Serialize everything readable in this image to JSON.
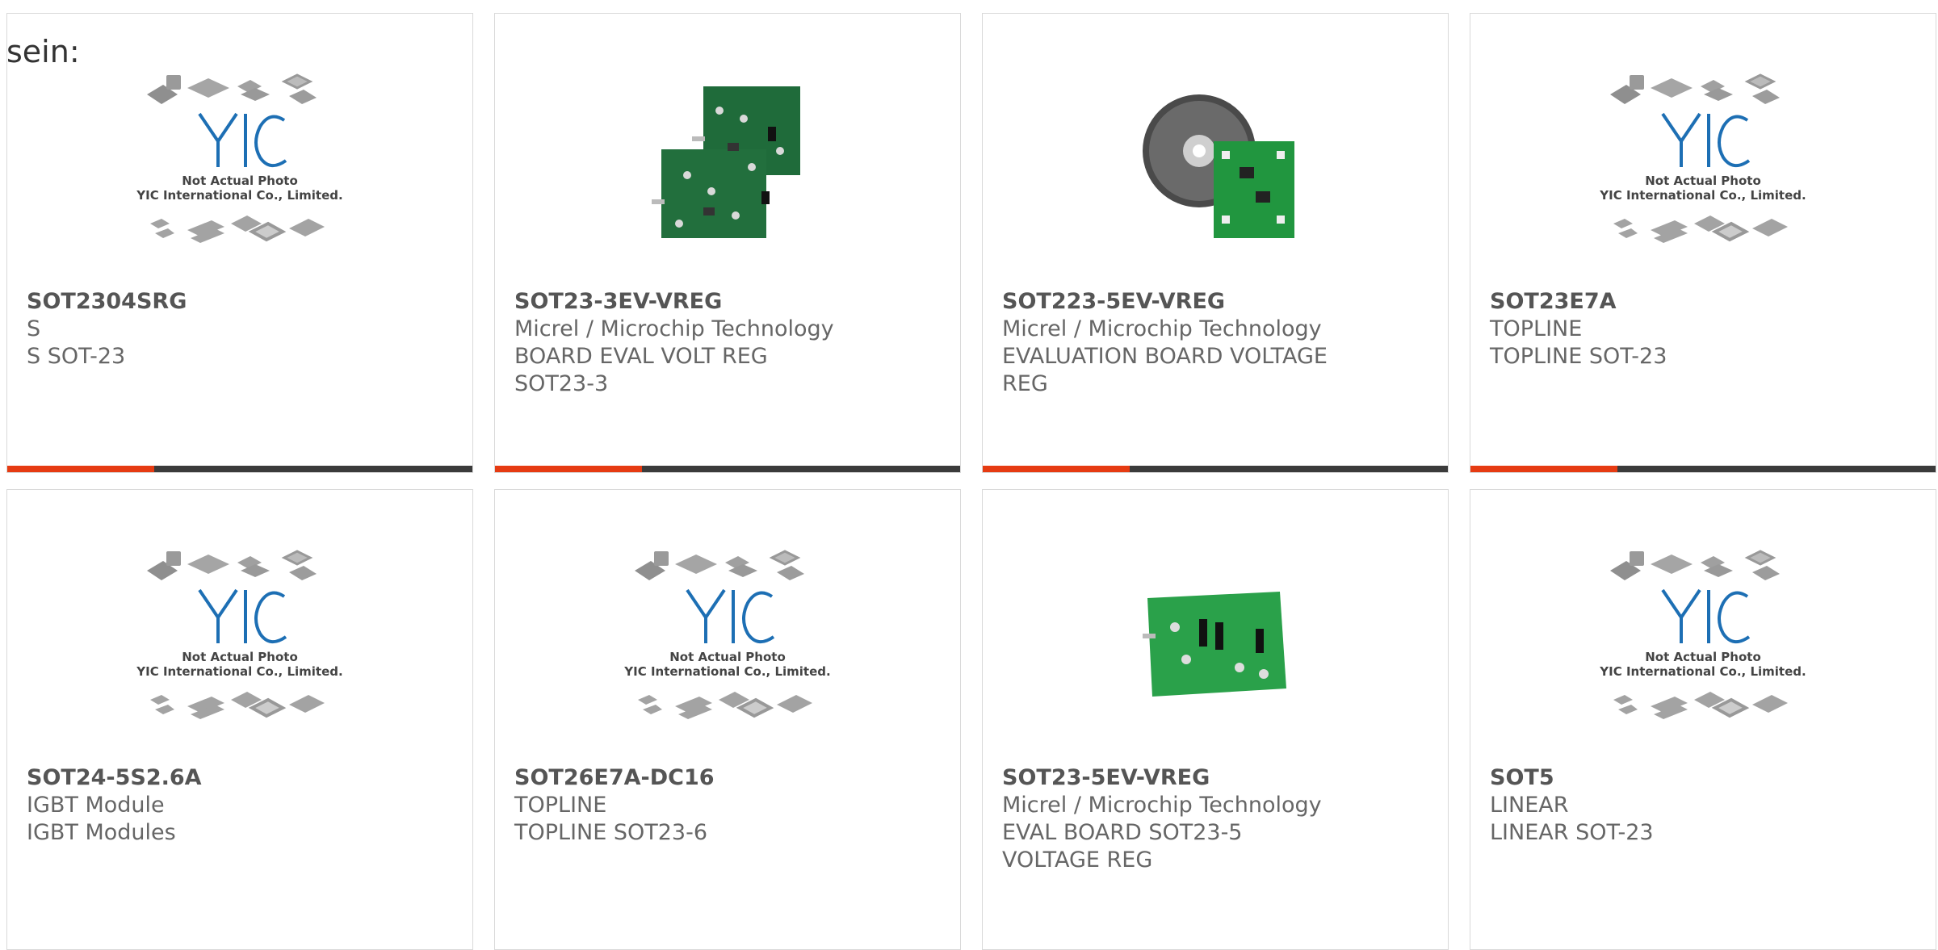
{
  "intro_text": "sein:",
  "placeholder": {
    "caption_line1": "Not Actual Photo",
    "caption_line2": "YIC International Co., Limited.",
    "logo_text": "YIC"
  },
  "accent_color": "#e63b12",
  "bar_color": "#3b3b3b",
  "products": [
    {
      "part": "SOT2304SRG",
      "manufacturer": "S",
      "description": "S SOT-23",
      "image": "placeholder"
    },
    {
      "part": "SOT23-3EV-VREG",
      "manufacturer": "Micrel / Microchip Technology",
      "description": "BOARD EVAL VOLT REG SOT23-3",
      "image": "dual-boards"
    },
    {
      "part": "SOT223-5EV-VREG",
      "manufacturer": "Micrel / Microchip Technology",
      "description": "EVALUATION BOARD VOLTAGE REG",
      "image": "cd-and-board"
    },
    {
      "part": "SOT23E7A",
      "manufacturer": "TOPLINE",
      "description": "TOPLINE SOT-23",
      "image": "placeholder"
    },
    {
      "part": "SOT24-5S2.6A",
      "manufacturer": "IGBT Module",
      "description": "IGBT Modules",
      "image": "placeholder"
    },
    {
      "part": "SOT26E7A-DC16",
      "manufacturer": "TOPLINE",
      "description": "TOPLINE SOT23-6",
      "image": "placeholder"
    },
    {
      "part": "SOT23-5EV-VREG",
      "manufacturer": "Micrel / Microchip Technology",
      "description": "EVAL BOARD SOT23-5 VOLTAGE REG",
      "image": "single-board"
    },
    {
      "part": "SOT5",
      "manufacturer": "LINEAR",
      "description": "LINEAR SOT-23",
      "image": "placeholder"
    }
  ]
}
